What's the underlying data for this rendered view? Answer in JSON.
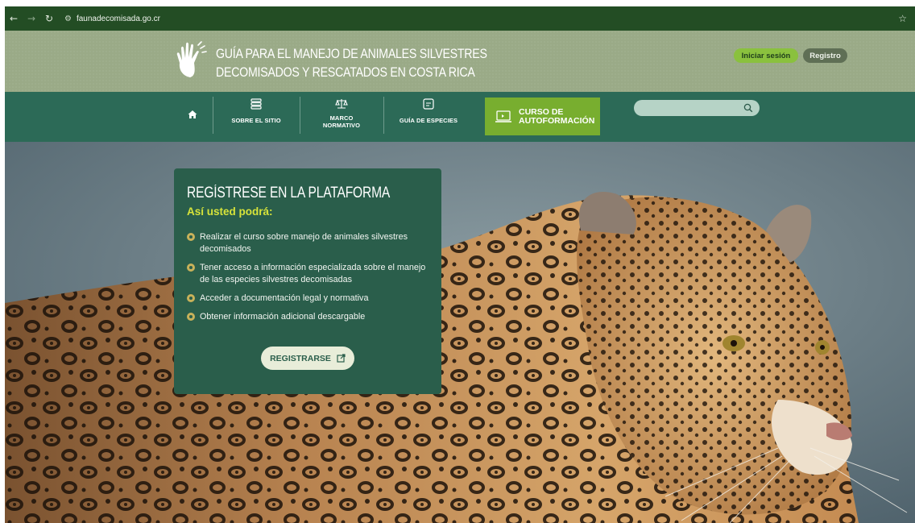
{
  "browser": {
    "url": "faunadecomisada.go.cr"
  },
  "header": {
    "title_line1": "GUÍA PARA EL MANEJO DE ANIMALES SILVESTRES",
    "title_line2": "DECOMISADOS Y RESCATADOS EN COSTA RICA",
    "login_label": "Iniciar sesión",
    "register_label": "Registro"
  },
  "nav": {
    "items": [
      {
        "label": "SOBRE EL SITIO",
        "icon": "list-icon"
      },
      {
        "label_line1": "MARCO",
        "label_line2": "NORMATIVO",
        "icon": "scales-icon"
      },
      {
        "label": "GUÍA DE ESPECIES",
        "icon": "guide-book-icon"
      }
    ],
    "curso_line1": "CURSO DE",
    "curso_line2": "AUTOFORMACIÓN",
    "search_placeholder": ""
  },
  "card": {
    "title": "REGÍSTRESE EN LA PLATAFORMA",
    "subtitle": "Así usted podrá:",
    "items": [
      "Realizar el curso sobre manejo de animales silvestres decomisados",
      "Tener acceso a información especializada sobre el manejo de las especies silvestres decomisadas",
      "Acceder a documentación legal y normativa",
      "Obtener información adicional descargable"
    ],
    "button_label": "REGISTRARSE"
  },
  "colors": {
    "header_bg": "#9aaa87",
    "nav_bg": "#2c6a57",
    "accent_green": "#78ae2f",
    "card_bg": "#2a5e4b",
    "highlight_yellow": "#d7e33a"
  }
}
